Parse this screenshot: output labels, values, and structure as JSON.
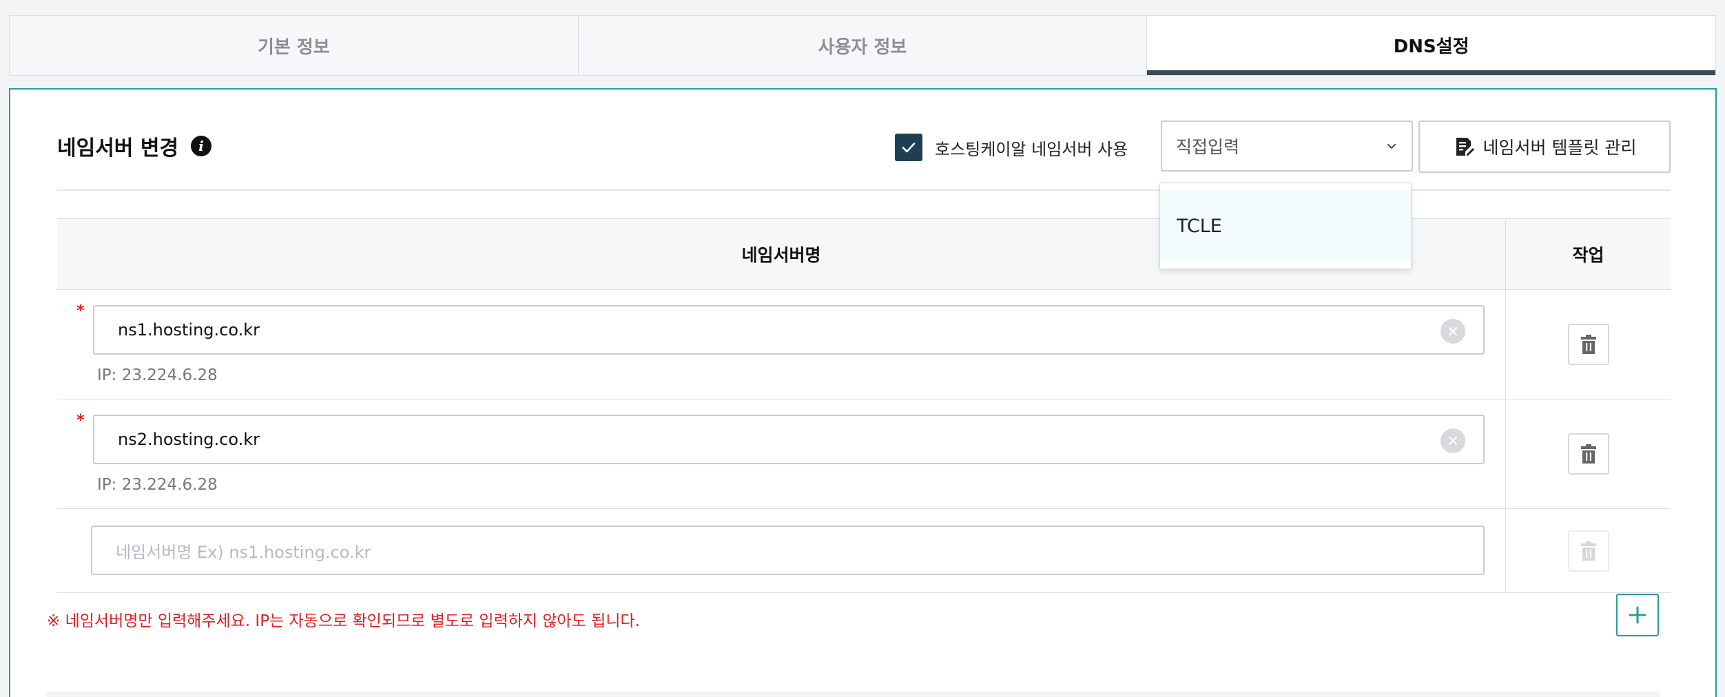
{
  "tabs": [
    {
      "label": "기본 정보"
    },
    {
      "label": "사용자 정보"
    },
    {
      "label": "DNS설정"
    }
  ],
  "section": {
    "title": "네임서버 변경",
    "hosting_checkbox_label": "호스팅케이알 네임서버 사용",
    "select_value": "직접입력",
    "template_button_label": "네임서버 템플릿 관리"
  },
  "dropdown": {
    "options": [
      "TCLE"
    ]
  },
  "table": {
    "headers": {
      "name": "네임서버명",
      "action": "작업"
    },
    "rows": [
      {
        "value": "ns1.hosting.co.kr",
        "ip": "IP: 23.224.6.28",
        "required": "*"
      },
      {
        "value": "ns2.hosting.co.kr",
        "ip": "IP: 23.224.6.28",
        "required": "*"
      }
    ],
    "empty_placeholder": "네임서버명 Ex) ns1.hosting.co.kr"
  },
  "notice": "※ 네임서버명만 입력해주세요. IP는 자동으로 확인되므로 별도로 입력하지 않아도 됩니다.",
  "colors": {
    "accent": "#2a9a9a",
    "checkbox": "#1e3e54",
    "warning": "#e02020",
    "active_tab_bar": "#3b4a55"
  },
  "icons": {
    "info": "info-icon",
    "check": "check-icon",
    "chevron": "chevron-down-icon",
    "template": "edit-document-icon",
    "clear": "clear-icon",
    "trash": "trash-icon",
    "add": "plus-icon"
  }
}
